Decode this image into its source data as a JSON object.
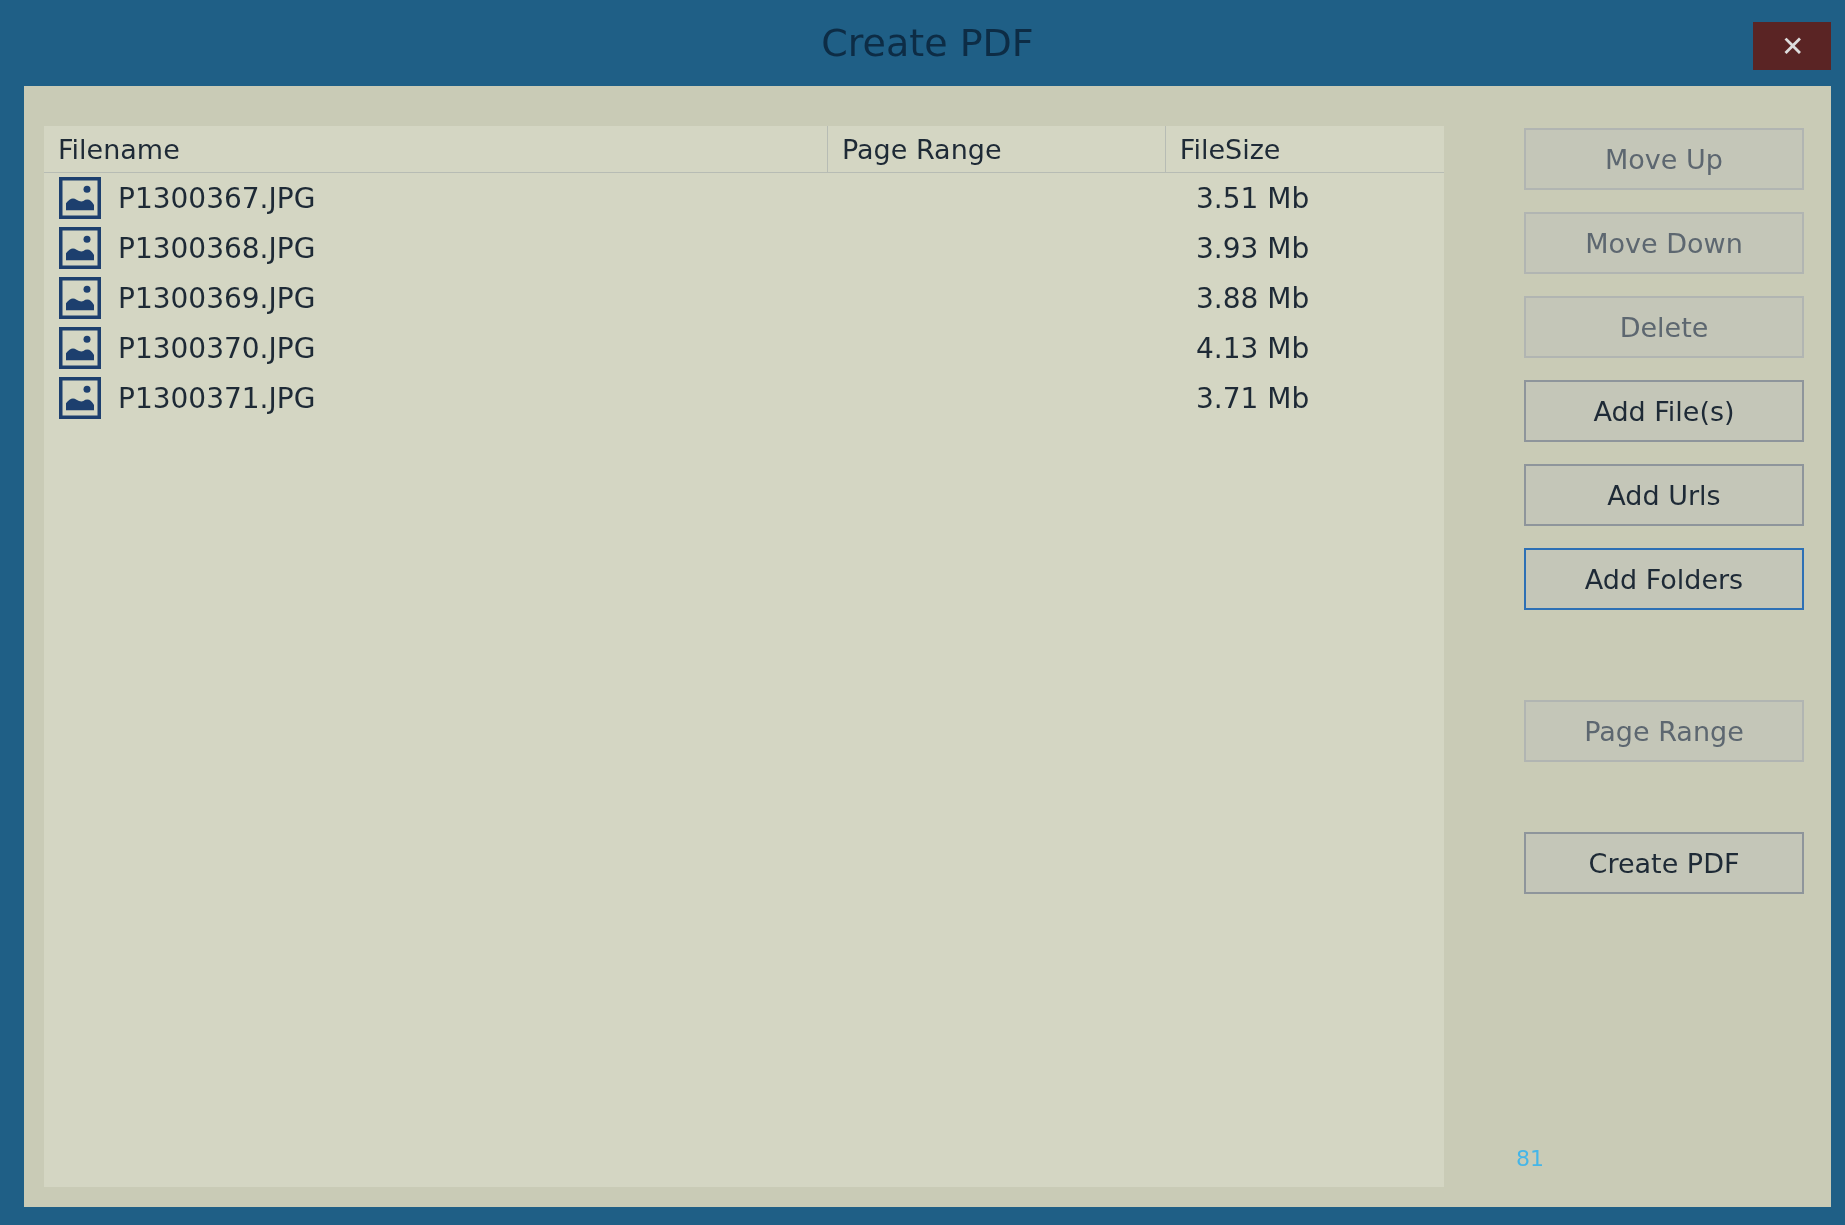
{
  "window": {
    "title": "Create PDF",
    "close": "✕"
  },
  "table": {
    "columns": [
      "Filename",
      "Page Range",
      "FileSize"
    ],
    "rows": [
      {
        "filename": "P1300367.JPG",
        "file_size": "3.51 Mb"
      },
      {
        "filename": "P1300368.JPG",
        "file_size": "3.93 Mb"
      },
      {
        "filename": "P1300369.JPG",
        "file_size": "3.88 Mb"
      },
      {
        "filename": "P1300370.JPG",
        "file_size": "4.13 Mb"
      },
      {
        "filename": "P1300371.JPG",
        "file_size": "3.71 Mb"
      }
    ]
  },
  "button_groups": [
    [
      {
        "label": "Move Up",
        "disabled": true,
        "focused": false
      },
      {
        "label": "Move Down",
        "disabled": true,
        "focused": false
      },
      {
        "label": "Delete",
        "disabled": true,
        "focused": false
      },
      {
        "label": "Add File(s)",
        "disabled": false,
        "focused": false
      },
      {
        "label": "Add Urls",
        "disabled": false,
        "focused": false
      },
      {
        "label": "Add Folders",
        "disabled": false,
        "focused": true
      }
    ],
    [
      {
        "label": "Page Range",
        "disabled": true,
        "focused": false
      }
    ],
    [
      {
        "label": "Create PDF",
        "disabled": false,
        "focused": false
      }
    ]
  ],
  "page_number": "81"
}
